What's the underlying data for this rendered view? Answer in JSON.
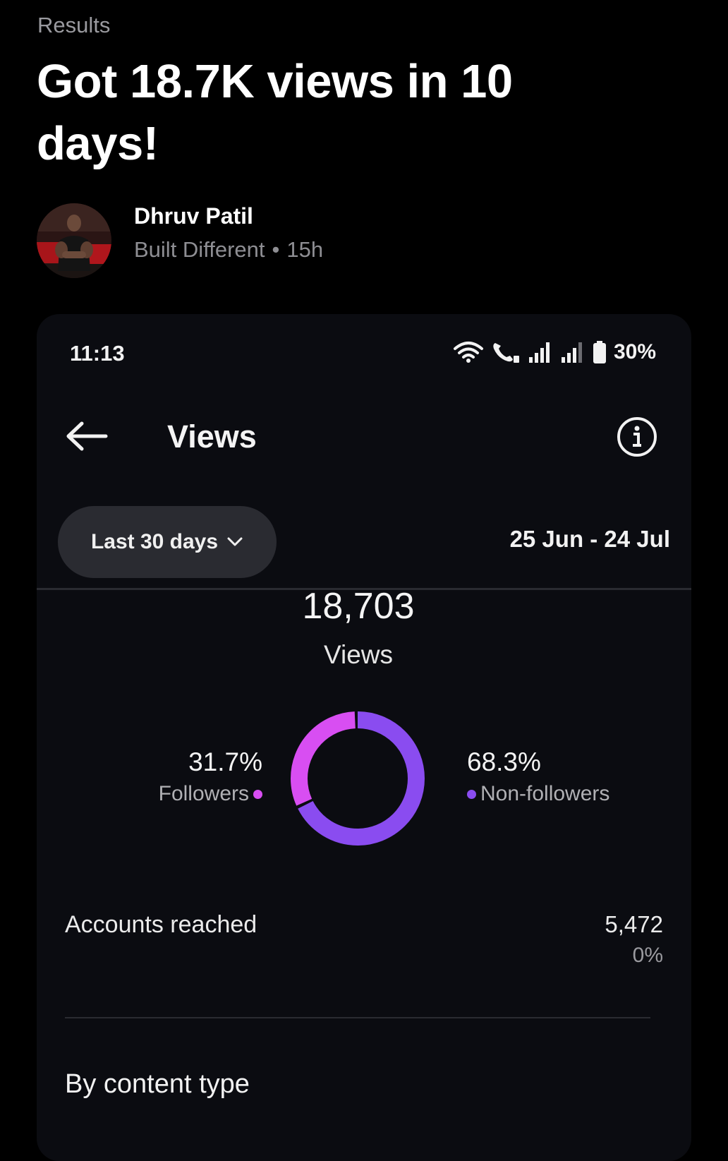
{
  "post": {
    "category": "Results",
    "title": "Got 18.7K views in 10 days!",
    "author": {
      "name": "Dhruv Patil",
      "group": "Built Different",
      "separator": "•",
      "time": "15h"
    }
  },
  "screen": {
    "status_bar": {
      "time": "11:13",
      "battery": "30%",
      "icons": [
        "wifi-icon",
        "wifi-calling-icon",
        "signal-icon",
        "signal-icon",
        "battery-icon"
      ]
    },
    "header": {
      "back_icon": "arrow-left-icon",
      "title": "Views",
      "info_icon": "info-icon"
    },
    "filter": {
      "selected": "Last 30 days",
      "dropdown_icon": "chevron-down-icon",
      "date_range": "25 Jun - 24 Jul"
    },
    "summary": {
      "total": "18,703",
      "label": "Views"
    },
    "breakdown": {
      "followers": {
        "percent": "31.7%",
        "label": "Followers",
        "value": 31.7,
        "color": "#d84ef2"
      },
      "non_followers": {
        "percent": "68.3%",
        "label": "Non-followers",
        "value": 68.3,
        "color": "#8a4cf0"
      }
    },
    "accounts_reached": {
      "label": "Accounts reached",
      "value": "5,472",
      "change": "0%"
    },
    "section_title": "By content type"
  }
}
